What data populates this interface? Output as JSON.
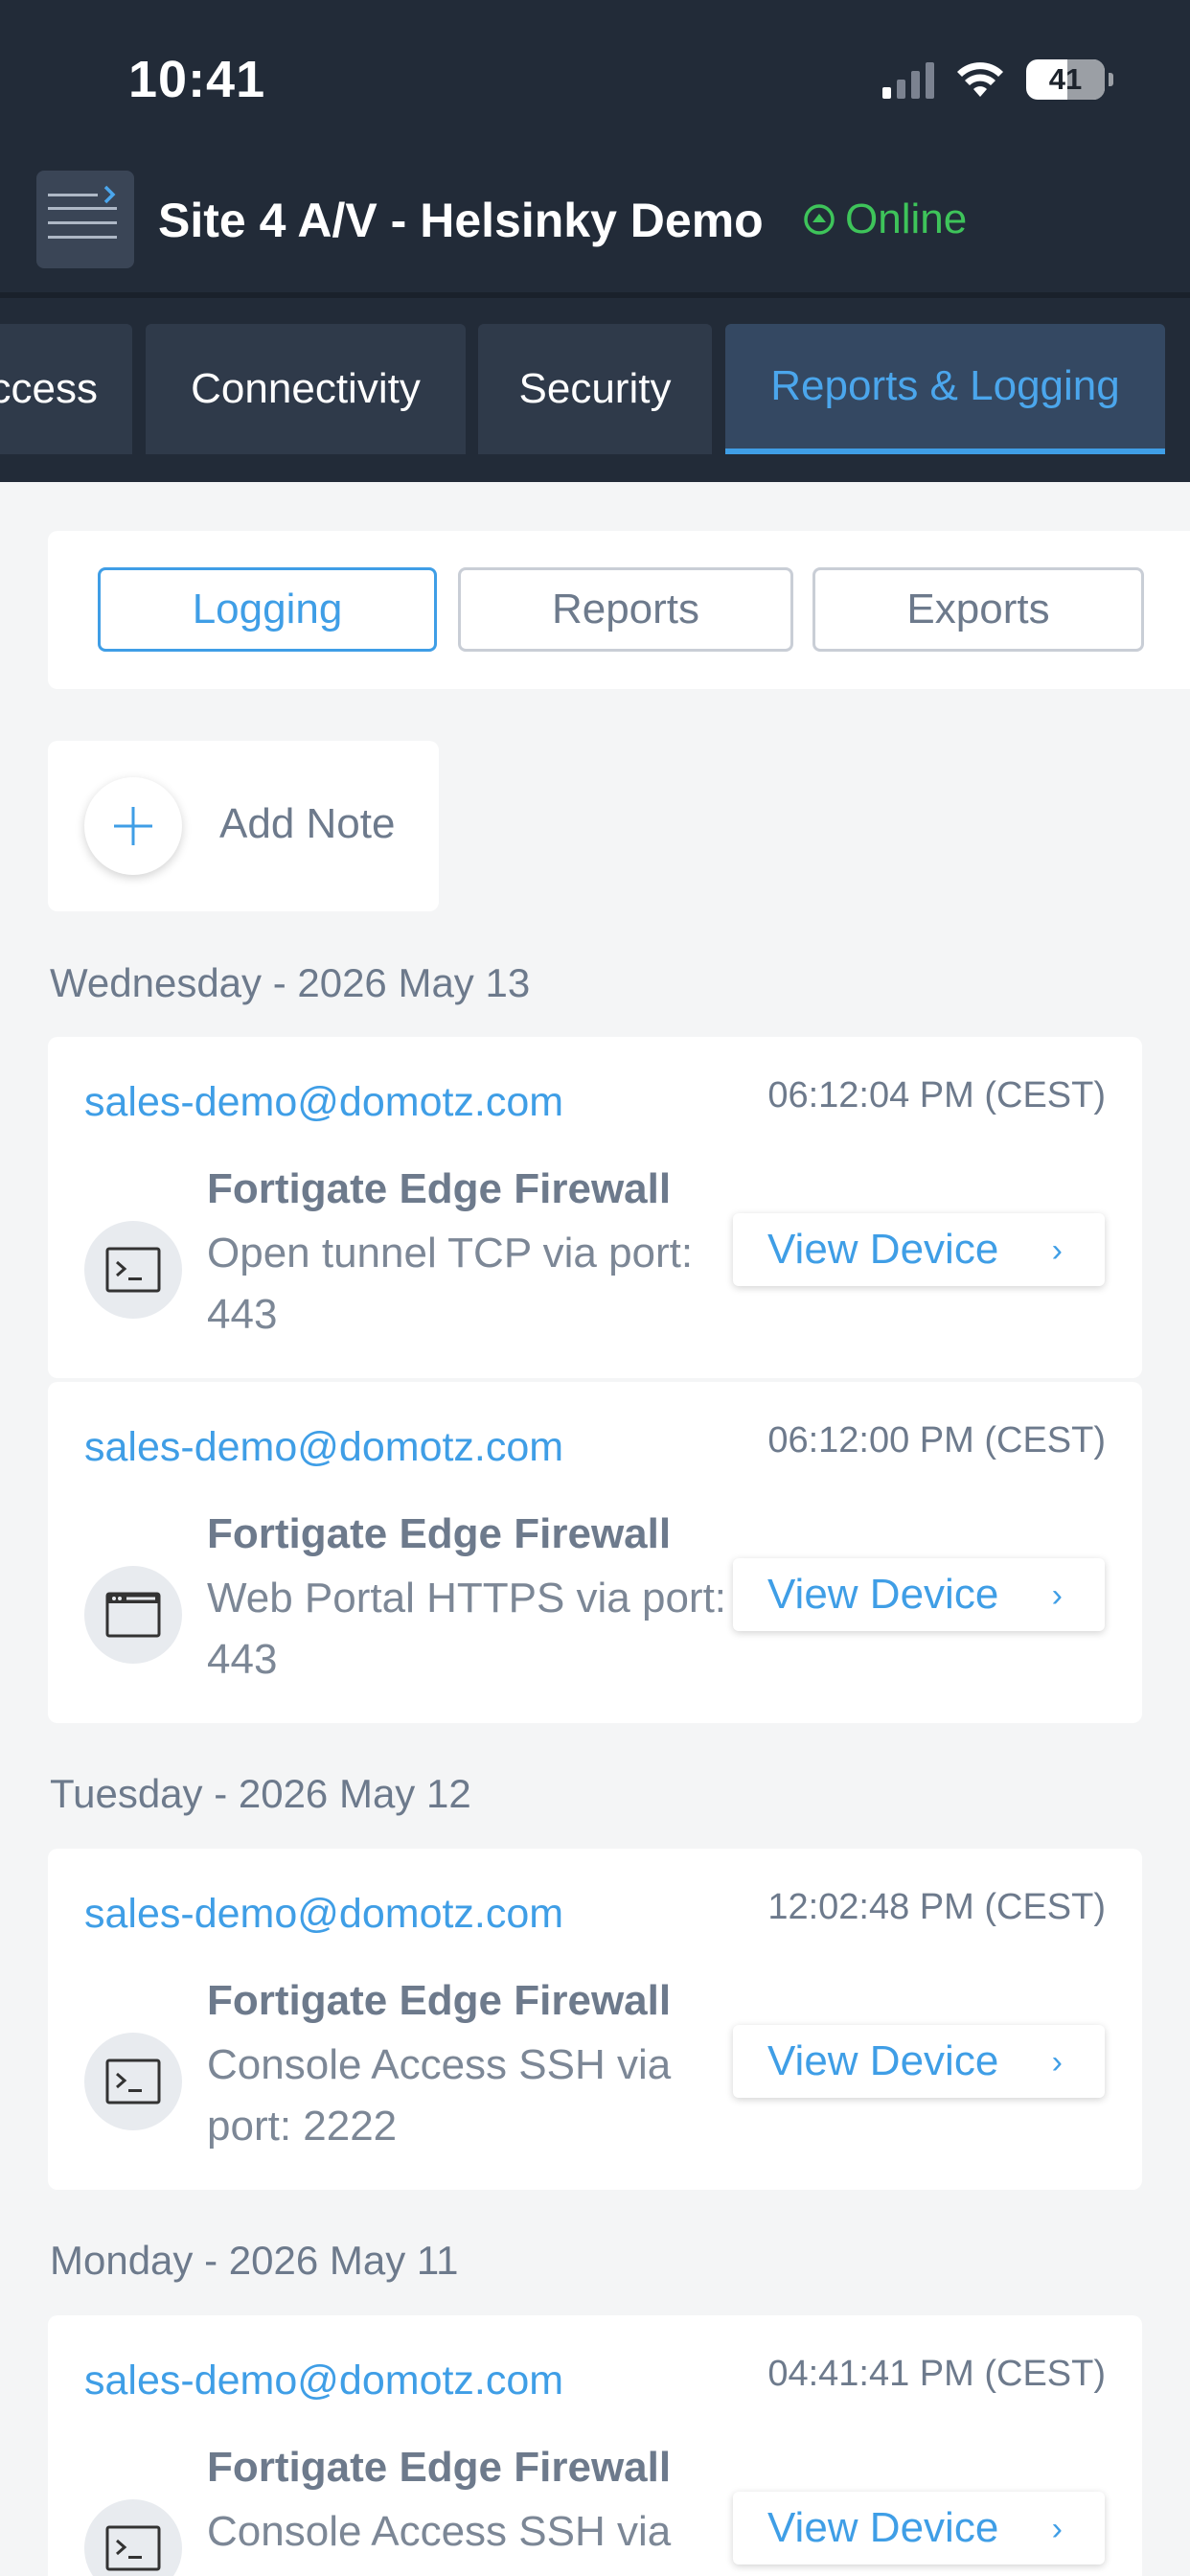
{
  "status_bar": {
    "time": "10:41",
    "battery": "41"
  },
  "header": {
    "title": "Site 4 A/V - Helsinky Demo",
    "status": "Online",
    "status_color": "#3ec45a"
  },
  "tabs": [
    {
      "label": "Access",
      "visible_label": "ccess"
    },
    {
      "label": "Connectivity"
    },
    {
      "label": "Security"
    },
    {
      "label": "Reports & Logging",
      "active": true
    }
  ],
  "segments": [
    {
      "label": "Logging",
      "active": true
    },
    {
      "label": "Reports"
    },
    {
      "label": "Exports"
    }
  ],
  "add_note": {
    "label": "Add Note"
  },
  "days": [
    {
      "label": "Wednesday - 2026 May 13"
    },
    {
      "label": "Tuesday - 2026 May 12"
    },
    {
      "label": "Monday - 2026 May 11"
    }
  ],
  "entries": [
    {
      "user": "sales-demo@domotz.com",
      "time": "06:12:04 PM (CEST)",
      "device": "Fortigate Edge Firewall",
      "description": "Open tunnel TCP via port: 443",
      "icon": "terminal-icon",
      "button": "View Device"
    },
    {
      "user": "sales-demo@domotz.com",
      "time": "06:12:00 PM (CEST)",
      "device": "Fortigate Edge Firewall",
      "description": "Web Portal HTTPS via port: 443",
      "icon": "browser-window-icon",
      "button": "View Device"
    },
    {
      "user": "sales-demo@domotz.com",
      "time": "12:02:48 PM (CEST)",
      "device": "Fortigate Edge Firewall",
      "description": "Console Access SSH via port: 2222",
      "icon": "terminal-icon",
      "button": "View Device"
    },
    {
      "user": "sales-demo@domotz.com",
      "time": "04:41:41 PM (CEST)",
      "device": "Fortigate Edge Firewall",
      "description": "Console Access SSH via",
      "icon": "terminal-icon",
      "button": "View Device"
    }
  ],
  "colors": {
    "accent": "#3f9ee6",
    "header_bg": "#222b38",
    "muted_text": "#6d7a8c"
  }
}
